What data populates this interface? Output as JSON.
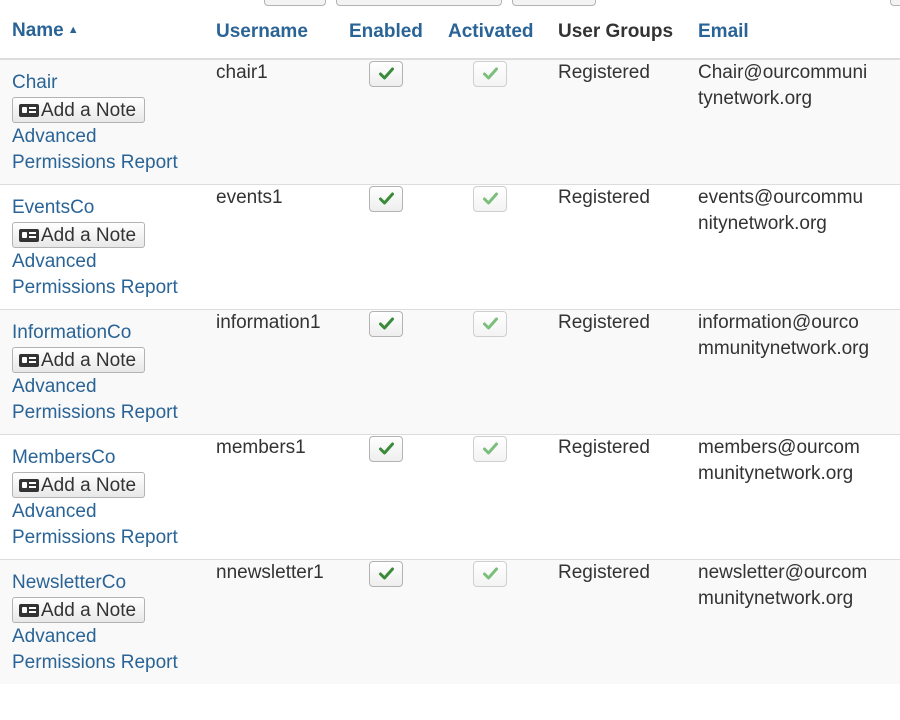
{
  "colors": {
    "link": "#2a6496",
    "text": "#333333",
    "check_enabled": "#3a8a3a",
    "check_activated": "#7cbf7c",
    "row_alt": "#f9f9f9"
  },
  "table": {
    "headers": {
      "name": "Name",
      "username": "Username",
      "enabled": "Enabled",
      "activated": "Activated",
      "user_groups": "User Groups",
      "email": "Email"
    },
    "sort_indicator": "caret-up-icon",
    "note_button_label": "Add a Note",
    "note_icon": "id-card-icon",
    "permissions_link": [
      "Advanced",
      "Permissions Report"
    ],
    "rows": [
      {
        "name": "Chair",
        "username": "chair1",
        "enabled": true,
        "activated": true,
        "user_groups": "Registered",
        "email_lines": [
          "Chair@ourcommuni",
          "tynetwork.org"
        ]
      },
      {
        "name": "EventsCo",
        "username": "events1",
        "enabled": true,
        "activated": true,
        "user_groups": "Registered",
        "email_lines": [
          "events@ourcommu",
          "nitynetwork.org"
        ]
      },
      {
        "name": "InformationCo",
        "username": "information1",
        "enabled": true,
        "activated": true,
        "user_groups": "Registered",
        "email_lines": [
          "information@ourco",
          "mmunitynetwork.org"
        ]
      },
      {
        "name": "MembersCo",
        "username": "members1",
        "enabled": true,
        "activated": true,
        "user_groups": "Registered",
        "email_lines": [
          "members@ourcom",
          "munitynetwork.org"
        ]
      },
      {
        "name": "NewsletterCo",
        "username": "nnewsletter1",
        "enabled": true,
        "activated": true,
        "user_groups": "Registered",
        "email_lines": [
          "newsletter@ourcom",
          "munitynetwork.org"
        ]
      }
    ]
  }
}
